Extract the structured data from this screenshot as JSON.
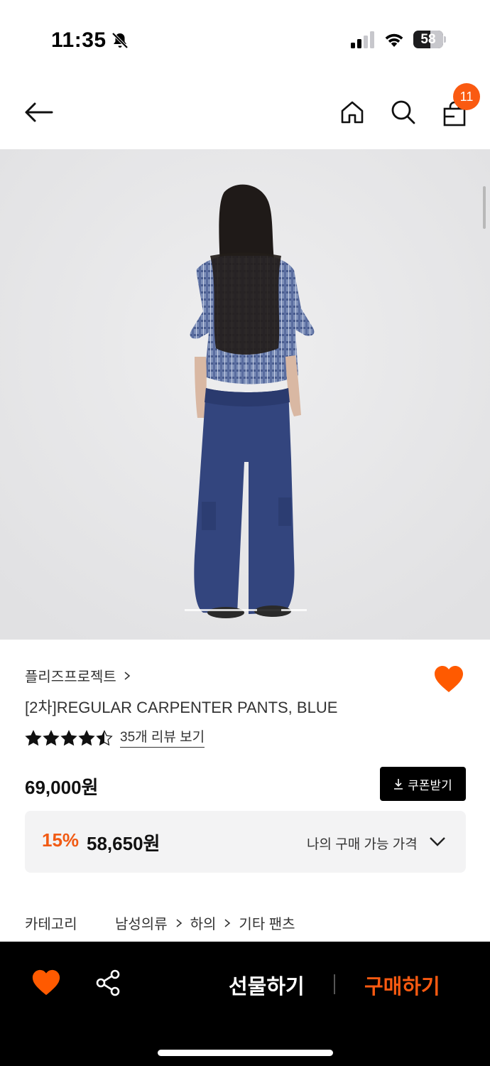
{
  "status_bar": {
    "time": "11:35",
    "battery": "58",
    "battery_level": 0.58
  },
  "header": {
    "cart_count": "11"
  },
  "product": {
    "brand": "플리즈프로젝트",
    "title": "[2차]REGULAR CARPENTER PANTS, BLUE",
    "rating": 4.5,
    "review_link": "35개 리뷰 보기",
    "price": "69,000원",
    "coupon_label": "쿠폰받기",
    "discount_rate": "15%",
    "discount_price": "58,650원",
    "my_price_label": "나의 구매 가능 가격",
    "category_label": "카테고리",
    "categories": [
      "남성의류",
      "하의",
      "기타 팬츠"
    ],
    "like_color": "#ff5a00",
    "accent_color": "#fa5a11"
  },
  "image": {
    "slide_current": 0.6
  },
  "bottom_bar": {
    "gift_label": "선물하기",
    "buy_label": "구매하기"
  }
}
